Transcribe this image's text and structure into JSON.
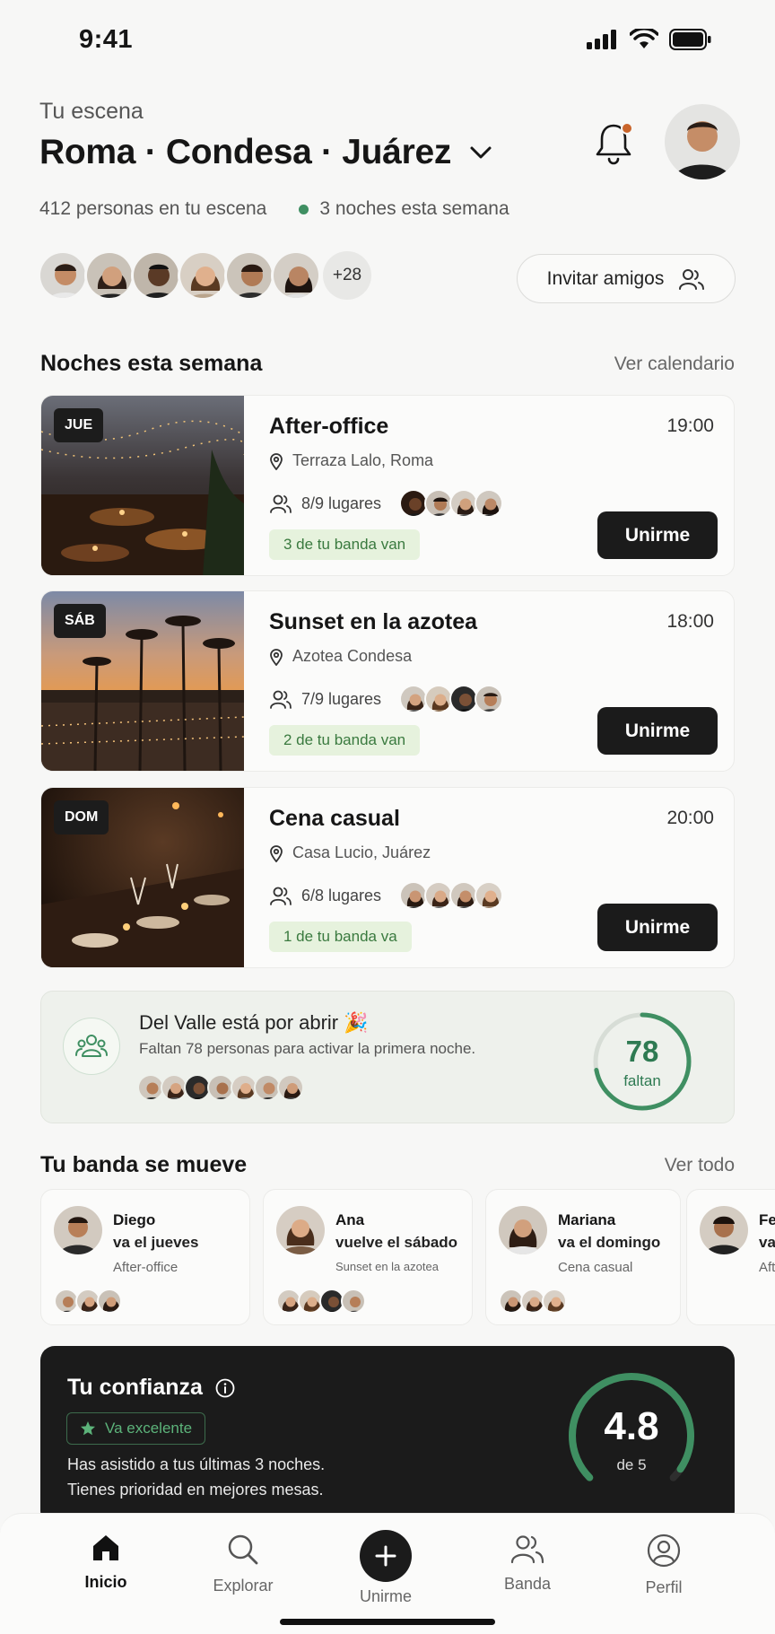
{
  "status": {
    "time": "9:41"
  },
  "header": {
    "kicker": "Tu escena",
    "title": "Roma · Condesa · Juárez",
    "members_text": "412 personas en tu escena",
    "nights_text": "3 noches esta semana",
    "more_count": "+28",
    "invite_label": "Invitar amigos"
  },
  "nights": {
    "title": "Noches esta semana",
    "link": "Ver calendario",
    "events": [
      {
        "day": "JUE",
        "title": "After-office",
        "time": "19:00",
        "place": "Terraza Lalo, Roma",
        "spots": "8/9 lugares",
        "tag": "3 de tu banda van",
        "join": "Unirme"
      },
      {
        "day": "SÁB",
        "title": "Sunset en la azotea",
        "time": "18:00",
        "place": "Azotea Condesa",
        "spots": "7/9 lugares",
        "tag": "2 de tu banda van",
        "join": "Unirme"
      },
      {
        "day": "DOM",
        "title": "Cena casual",
        "time": "20:00",
        "place": "Casa Lucio, Juárez",
        "spots": "6/8 lugares",
        "tag": "1 de tu banda va",
        "join": "Unirme"
      }
    ]
  },
  "promo": {
    "title": "Del Valle está por abrir 🎉",
    "subtitle": "Faltan 78 personas para activar la primera noche.",
    "count": "78",
    "count_label": "faltan",
    "progress": 0.72
  },
  "band": {
    "title": "Tu banda se mueve",
    "link": "Ver todo",
    "friends": [
      {
        "name": "Diego",
        "line": "va el jueves",
        "event": "After-office"
      },
      {
        "name": "Ana",
        "line": "vuelve el sábado",
        "event": "Sunset en la azotea"
      },
      {
        "name": "Mariana",
        "line": "va el domingo",
        "event": "Cena casual"
      },
      {
        "name": "Fer",
        "line": "va",
        "event": "Afte"
      }
    ]
  },
  "trust": {
    "title": "Tu confianza",
    "badge": "Va excelente",
    "line1": "Has asistido a tus últimas 3 noches.",
    "line2": "Tienes prioridad en mejores mesas.",
    "score": "4.8",
    "score_of": "de 5",
    "score_value": 4.8,
    "score_max": 5
  },
  "tabs": {
    "home": "Inicio",
    "explore": "Explorar",
    "join": "Unirme",
    "band": "Banda",
    "profile": "Perfil"
  },
  "colors": {
    "accent_green": "#3f8f62",
    "notification": "#c9642a",
    "dark": "#1b1b1b"
  }
}
